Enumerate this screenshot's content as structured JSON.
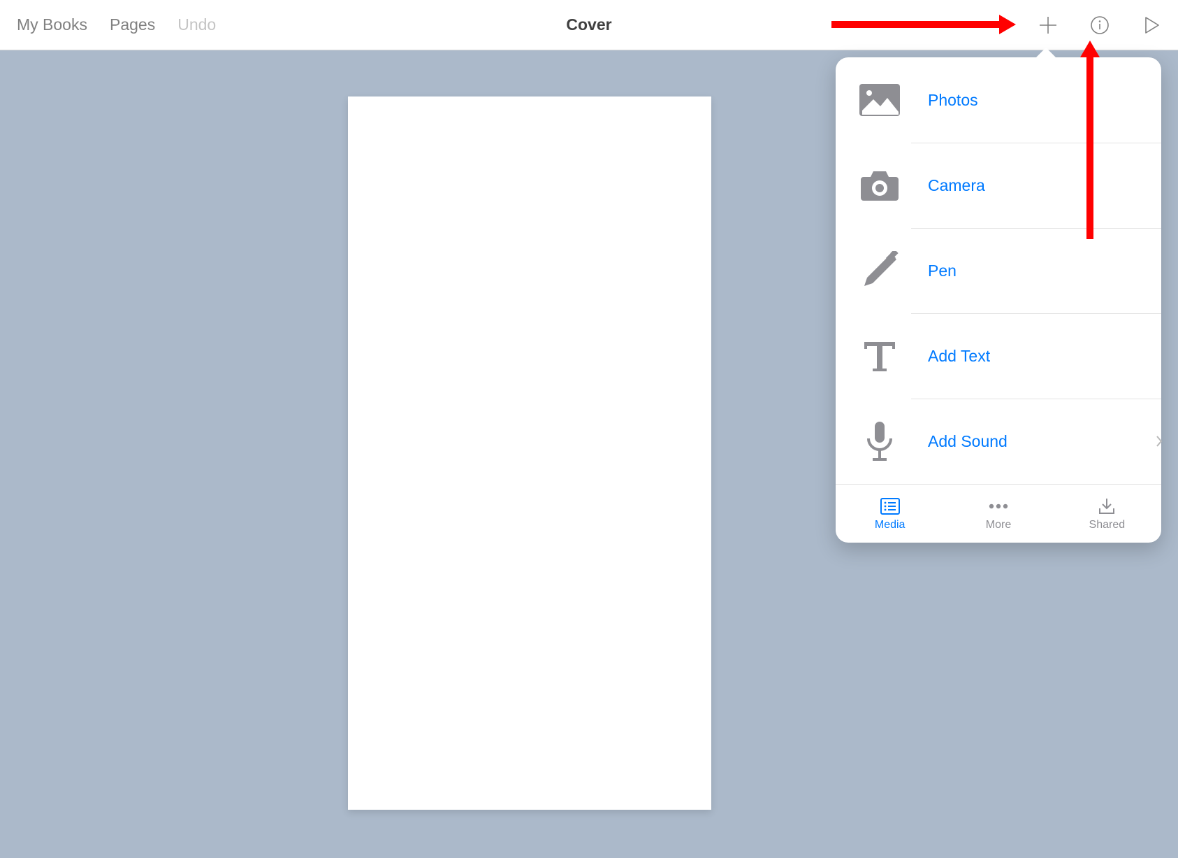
{
  "toolbar": {
    "my_books": "My Books",
    "pages": "Pages",
    "undo": "Undo",
    "title": "Cover"
  },
  "popover": {
    "items": [
      {
        "label": "Photos",
        "icon": "image-icon"
      },
      {
        "label": "Camera",
        "icon": "camera-icon"
      },
      {
        "label": "Pen",
        "icon": "pen-icon"
      },
      {
        "label": "Add Text",
        "icon": "text-icon"
      },
      {
        "label": "Add Sound",
        "icon": "mic-icon",
        "has_chevron": true
      }
    ],
    "tabs": [
      {
        "label": "Media",
        "icon": "list-icon",
        "active": true
      },
      {
        "label": "More",
        "icon": "more-icon",
        "active": false
      },
      {
        "label": "Shared",
        "icon": "download-icon",
        "active": false
      }
    ]
  }
}
